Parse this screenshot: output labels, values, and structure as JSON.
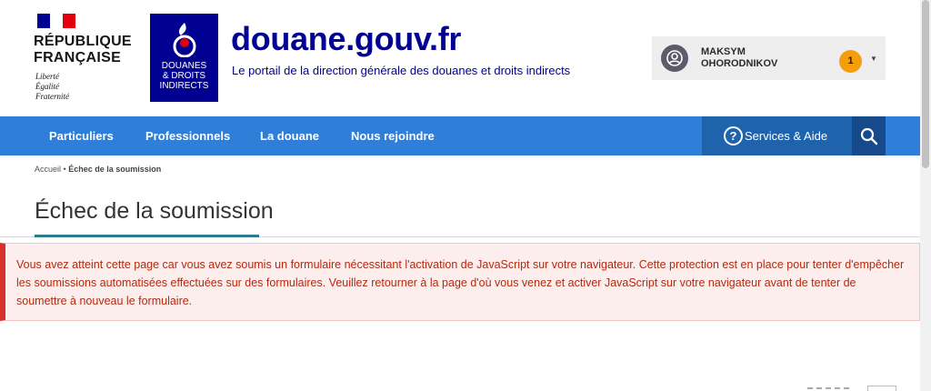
{
  "header": {
    "rf_name": "RÉPUBLIQUE\nFRANÇAISE",
    "rf_motto": "Liberté\nÉgalité\nFraternité",
    "douane_logo_text": "DOUANES\n& DROITS\nINDIRECTS",
    "site_title": "douane.gouv.fr",
    "site_tagline": "Le portail de la direction générale des douanes et droits indirects"
  },
  "user": {
    "name": "MAKSYM\nOHORODNIKOV",
    "notifications": "1",
    "avatar_icon": "user-circle-icon"
  },
  "nav": {
    "items": [
      {
        "label": "Particuliers"
      },
      {
        "label": "Professionnels"
      },
      {
        "label": "La douane"
      },
      {
        "label": "Nous rejoindre"
      }
    ],
    "services_label": "Services & Aide",
    "search_icon": "search-icon",
    "color": "#2f7ed8"
  },
  "breadcrumb": {
    "home": "Accueil",
    "separator": "•",
    "current": "Échec de la soumission"
  },
  "page": {
    "title": "Échec de la soumission"
  },
  "alert": {
    "text": "Vous avez atteint cette page car vous avez soumis un formulaire nécessitant l'activation de JavaScript sur votre navigateur. Cette protection est en place pour tenter d'empêcher les soumissions automatisées effectuées sur des formulaires. Veuillez retourner à la page d'où vous venez et activer JavaScript sur votre navigateur avant de tenter de soumettre à nouveau le formulaire.",
    "color": "#d7302a"
  }
}
